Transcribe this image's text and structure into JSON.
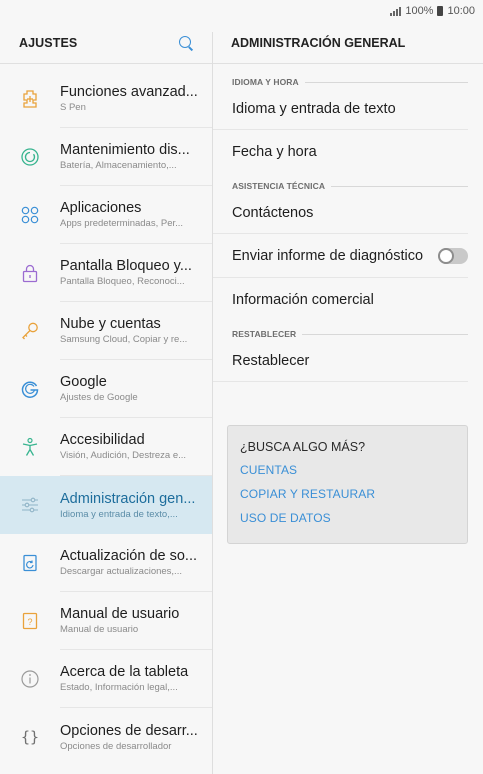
{
  "status_bar": {
    "battery": "100%",
    "time": "10:00"
  },
  "left_panel": {
    "title": "AJUSTES",
    "items": [
      {
        "label": "Funciones avanzad...",
        "sub": "S Pen",
        "icon": "advanced-features-icon"
      },
      {
        "label": "Mantenimiento dis...",
        "sub": "Batería, Almacenamiento,...",
        "icon": "device-maintenance-icon"
      },
      {
        "label": "Aplicaciones",
        "sub": "Apps predeterminadas, Per...",
        "icon": "apps-icon"
      },
      {
        "label": "Pantalla Bloqueo y...",
        "sub": "Pantalla Bloqueo, Reconoci...",
        "icon": "lock-icon"
      },
      {
        "label": "Nube y cuentas",
        "sub": "Samsung Cloud, Copiar y re...",
        "icon": "key-icon"
      },
      {
        "label": "Google",
        "sub": "Ajustes de Google",
        "icon": "google-icon"
      },
      {
        "label": "Accesibilidad",
        "sub": "Visión, Audición, Destreza e...",
        "icon": "accessibility-icon"
      },
      {
        "label": "Administración gen...",
        "sub": "Idioma y entrada de texto,...",
        "icon": "sliders-icon",
        "active": true
      },
      {
        "label": "Actualización de so...",
        "sub": "Descargar actualizaciones,...",
        "icon": "software-update-icon"
      },
      {
        "label": "Manual de usuario",
        "sub": "Manual de usuario",
        "icon": "user-manual-icon"
      },
      {
        "label": "Acerca de la tableta",
        "sub": "Estado, Información legal,...",
        "icon": "info-icon"
      },
      {
        "label": "Opciones de desarr...",
        "sub": "Opciones de desarrollador",
        "icon": "developer-braces-icon"
      }
    ]
  },
  "right_panel": {
    "title": "ADMINISTRACIÓN GENERAL",
    "sections": {
      "language": "IDIOMA Y HORA",
      "support": "ASISTENCIA TÉCNICA",
      "reset": "RESTABLECER"
    },
    "items": {
      "language_input": "Idioma y entrada de texto",
      "date_time": "Fecha y hora",
      "contact": "Contáctenos",
      "diagnostic": "Enviar informe de diagnóstico",
      "marketing": "Información comercial",
      "reset": "Restablecer"
    },
    "diagnostic_toggle_on": false,
    "more": {
      "title": "¿BUSCA ALGO MÁS?",
      "links": [
        "CUENTAS",
        "COPIAR Y RESTAURAR",
        "USO DE DATOS"
      ]
    }
  },
  "colors": {
    "accent": "#3a8fd6",
    "active_bg": "#d6e8f1",
    "icon_teal": "#37b48f",
    "icon_orange": "#e9a23b",
    "icon_purple": "#9b6bd1"
  }
}
